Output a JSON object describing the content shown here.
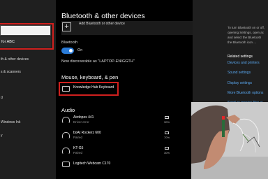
{
  "left_pane": {
    "suggestion": "for ABC",
    "items": [
      {
        "label": "th & other devices"
      },
      {
        "label": "s & scanners"
      },
      {
        "label": "d"
      },
      {
        "label": "Windows Ink"
      },
      {
        "label": "y"
      }
    ]
  },
  "main": {
    "title": "Bluetooth & other devices",
    "add_device_label": "Add Bluetooth or other device",
    "bluetooth_label": "Bluetooth",
    "toggle_state": "On",
    "discoverable_text": "Now discoverable as \"LAPTOP-ENIGGTH\"",
    "section_mouse": "Mouse, keyboard, & pen",
    "keyboard": {
      "name": "Knowledge Hub Keyboard"
    },
    "section_audio": "Audio",
    "audio_devices": [
      {
        "name": "Airdopes 441",
        "status": "Driver error",
        "battery": "30%",
        "icon": "headphones-icon"
      },
      {
        "name": "boAt Rockerz 600",
        "status": "Paired",
        "battery": "70%",
        "icon": "headphones-icon"
      },
      {
        "name": "KT-G5",
        "status": "Paired",
        "battery": "30%",
        "icon": "headphones-icon"
      },
      {
        "name": "Logitech Webcam C170",
        "status": "",
        "battery": "",
        "icon": "webcam-icon"
      }
    ]
  },
  "right_pane": {
    "help_lines": [
      "To turn Bluetooth on or off,",
      "opening Settings, open ac",
      "and select the Bluetooth",
      "the Bluetooth icon ..."
    ],
    "related_heading": "Related settings",
    "links": [
      "Devices and printers",
      "Sound settings",
      "Display settings",
      "More Bluetooth options",
      "Send or receive files vi"
    ]
  },
  "colors": {
    "accent": "#2a7bd8",
    "highlight": "#d0201e",
    "link": "#5aa8f0"
  }
}
